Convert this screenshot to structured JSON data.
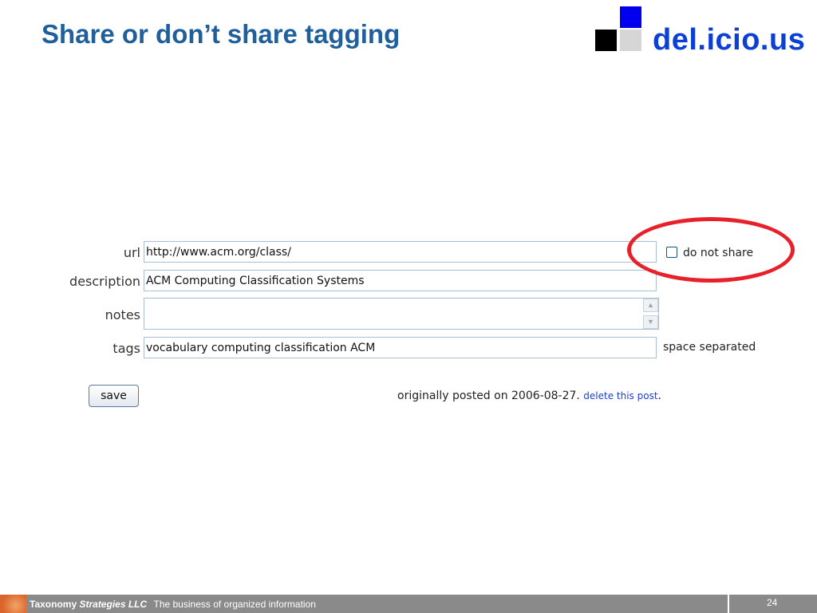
{
  "slide": {
    "title": "Share or don’t share tagging"
  },
  "logo": {
    "wordmark": "del.icio.us",
    "colors": {
      "blue": "#0000ee",
      "black": "#000000",
      "grey": "#d6d6d6",
      "text": "#0b3fd6"
    }
  },
  "form": {
    "url_label": "url",
    "url_value": "http://www.acm.org/class/",
    "description_label": "description",
    "description_value": "ACM Computing Classification Systems",
    "notes_label": "notes",
    "notes_value": "",
    "tags_label": "tags",
    "tags_value": "vocabulary computing classification ACM",
    "tags_hint": "space separated",
    "do_not_share_label": "do not share",
    "do_not_share_checked": false,
    "save_label": "save"
  },
  "meta": {
    "posted_text": "originally posted on 2006-08-27.",
    "delete_link": "delete this post",
    "posted_tail": "."
  },
  "footer": {
    "company_plain": "Taxonomy",
    "company_italic": "Strategies LLC",
    "tagline": "The business of organized information",
    "page_number": "24"
  },
  "colors": {
    "title": "#1f5f9c",
    "highlight_ellipse": "#e8202a",
    "link": "#1a3fd4",
    "footer_bg": "#8a8a8a"
  }
}
